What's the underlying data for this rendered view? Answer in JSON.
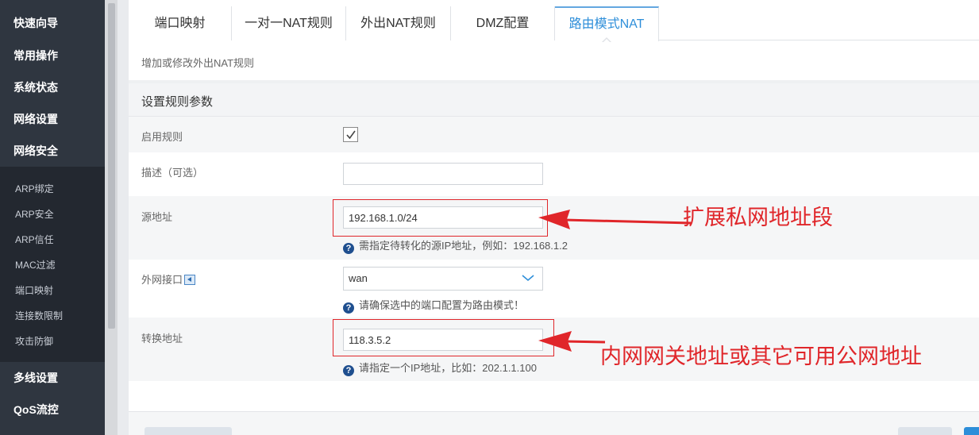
{
  "sidebar": {
    "top_items": [
      "快速向导",
      "常用操作",
      "系统状态",
      "网络设置",
      "网络安全"
    ],
    "sub_items": [
      "ARP绑定",
      "ARP安全",
      "ARP信任",
      "MAC过滤",
      "端口映射",
      "连接数限制",
      "攻击防御"
    ],
    "bottom_items": [
      "多线设置",
      "QoS流控"
    ]
  },
  "tabs": [
    "端口映射",
    "一对一NAT规则",
    "外出NAT规则",
    "DMZ配置",
    "路由模式NAT"
  ],
  "active_tab": "路由模式NAT",
  "page": {
    "description": "增加或修改外出NAT规则",
    "section_title": "设置规则参数"
  },
  "form": {
    "enable_label": "启用规则",
    "enable_checked": true,
    "desc_label": "描述（可选）",
    "desc_value": "",
    "source_label": "源地址",
    "source_value": "192.168.1.0/24",
    "source_hint": "需指定待转化的源IP地址，例如：192.168.1.2",
    "wan_label": "外网接口",
    "wan_value": "wan",
    "wan_hint": "请确保选中的端口配置为路由模式！",
    "translate_label": "转换地址",
    "translate_value": "118.3.5.2",
    "translate_hint": "请指定一个IP地址，比如：202.1.1.100"
  },
  "annotations": {
    "source_note": "扩展私网地址段",
    "translate_note": "内网网关地址或其它可用公网地址"
  },
  "colors": {
    "sidebar_bg": "#2f3640",
    "active_tab": "#2d8ed9",
    "annotation_red": "#e0262a"
  }
}
